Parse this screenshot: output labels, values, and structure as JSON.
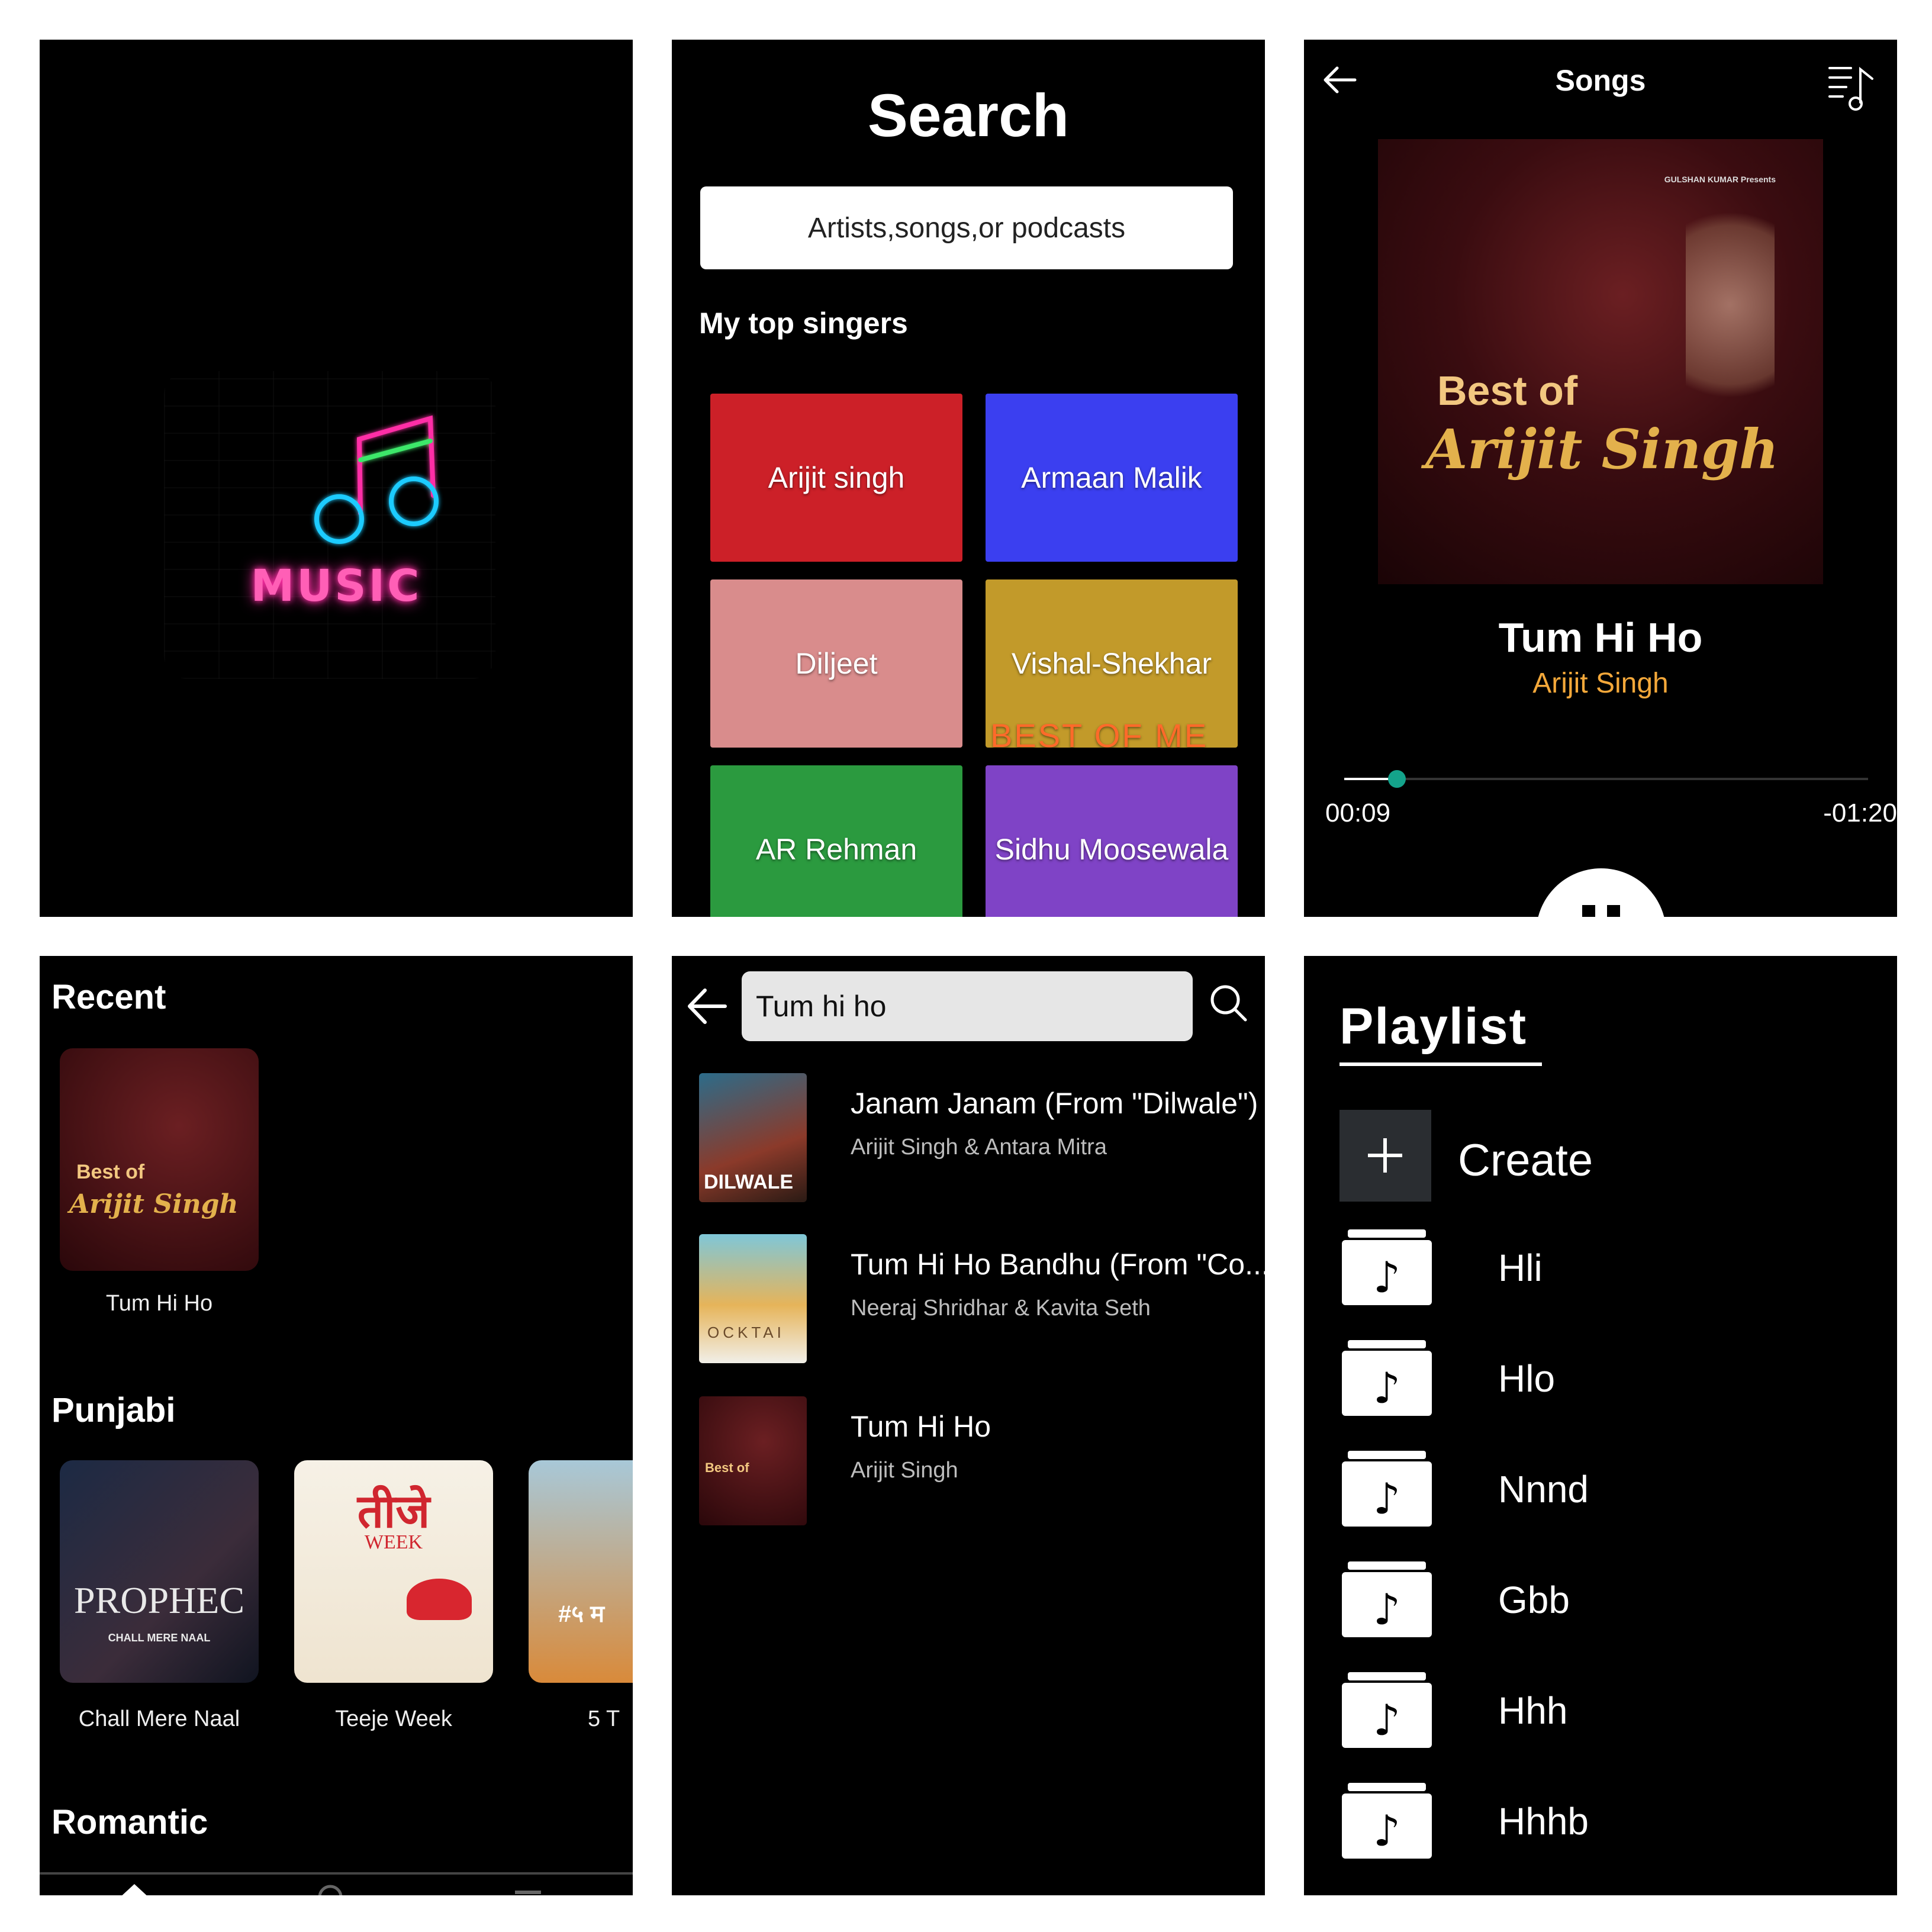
{
  "splash": {
    "logo_text": "MUSIC"
  },
  "search": {
    "title": "Search",
    "placeholder": "Artists,songs,or podcasts",
    "section": "My top singers",
    "singers": [
      {
        "name": "Arijit singh",
        "color": "#cc2028"
      },
      {
        "name": "Armaan Malik",
        "color": "#3b3ff0"
      },
      {
        "name": "Diljeet",
        "color": "#d98c8c"
      },
      {
        "name": "Vishal-Shekhar",
        "color": "#c29a2a"
      },
      {
        "name": "AR Rehman",
        "color": "#2b9a3f"
      },
      {
        "name": "Sidhu Moosewala",
        "color": "#7f43c6"
      }
    ],
    "tile_overlay_text": "BEST OF ME"
  },
  "player": {
    "title": "Songs",
    "cover": {
      "line1": "Best of",
      "line2": "Arijit Singh",
      "presenter": "GULSHAN KUMAR Presents"
    },
    "song": "Tum Hi Ho",
    "artist": "Arijit Singh",
    "elapsed": "00:09",
    "remaining": "-01:20",
    "progress": 0.1
  },
  "home": {
    "recent_title": "Recent",
    "recent": [
      {
        "title": "Tum Hi Ho",
        "cover_line1": "Best of",
        "cover_line2": "Arijit Singh"
      }
    ],
    "punjabi_title": "Punjabi",
    "punjabi": [
      {
        "title": "Chall Mere Naal",
        "cover_text": "PROPHEC",
        "cover_sub": "CHALL MERE NAAL"
      },
      {
        "title": "Teeje Week",
        "cover_text": "तीजे",
        "cover_sub": "WEEK"
      },
      {
        "title": "5 T",
        "cover_text": "#५ म"
      }
    ],
    "romantic_title": "Romantic"
  },
  "results": {
    "query": "Tum hi ho",
    "items": [
      {
        "title": "Janam Janam (From \"Dilwale\")",
        "subtitle": "Arijit Singh & Antara Mitra",
        "cover_text": "DILWALE"
      },
      {
        "title": "Tum Hi Ho Bandhu (From \"Co...",
        "subtitle": "Neeraj Shridhar & Kavita Seth",
        "cover_text": "OCKTAI"
      },
      {
        "title": "Tum Hi Ho",
        "subtitle": "Arijit Singh",
        "cover_text": "Best of"
      }
    ]
  },
  "playlist": {
    "title": "Playlist",
    "create_label": "Create",
    "items": [
      "Hli",
      "Hlo",
      "Nnnd",
      "Gbb",
      "Hhh",
      "Hhhb"
    ]
  }
}
